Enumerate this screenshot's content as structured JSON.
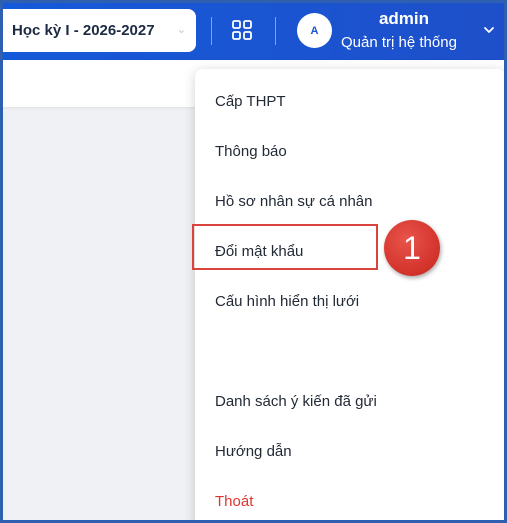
{
  "header": {
    "semester_label": "Học kỳ I - 2026-2027",
    "apps_icon": "grid-icon",
    "avatar_initial": "A",
    "user_name": "admin",
    "user_role": "Quản trị hệ thống",
    "brand_color": "#1a55d2"
  },
  "menu": {
    "items": [
      {
        "label": "Cấp THPT"
      },
      {
        "label": "Thông báo"
      },
      {
        "label": "Hồ sơ nhân sự cá nhân"
      },
      {
        "label": "Đổi mật khẩu"
      },
      {
        "label": "Cấu hình hiển thị lưới"
      },
      {
        "label": "Danh sách ý kiến đã gửi"
      },
      {
        "label": "Hướng dẫn"
      },
      {
        "label": "Thoát"
      }
    ],
    "logout_color": "#e0342f"
  },
  "annotation": {
    "step_number": "1",
    "highlight_color": "#d9453d"
  }
}
